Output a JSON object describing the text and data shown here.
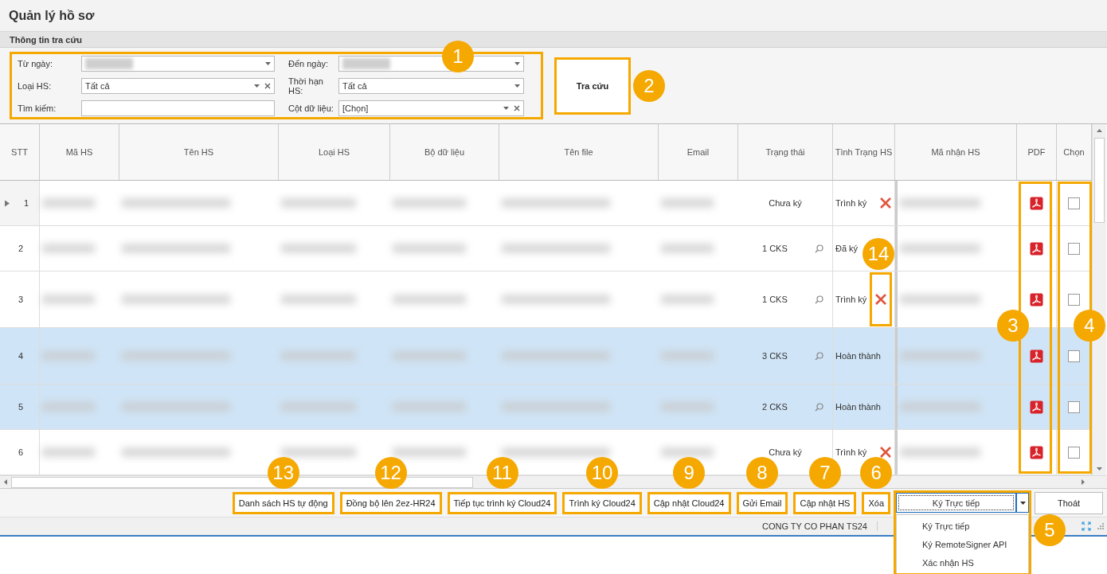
{
  "title": "Quản lý hồ sơ",
  "section_title": "Thông tin tra cứu",
  "filter_panel": {
    "callout": "1",
    "fields": [
      {
        "label": "Từ ngày:",
        "kind": "dropdown",
        "redacted": true
      },
      {
        "label": "Đến ngày:",
        "kind": "dropdown",
        "redacted": true
      },
      {
        "label": "Loại HS:",
        "kind": "dropdown",
        "value": "Tất cả",
        "clearable": true
      },
      {
        "label": "Thời hạn HS:",
        "kind": "dropdown",
        "value": "Tất cả"
      },
      {
        "label": "Tìm kiếm:",
        "kind": "text"
      },
      {
        "label": "Cột dữ liệu:",
        "kind": "dropdown",
        "value": "[Chọn]",
        "clearable": true
      }
    ]
  },
  "search_button": {
    "label": "Tra cứu",
    "callout": "2"
  },
  "table": {
    "columns": [
      "STT",
      "Mã HS",
      "Tên HS",
      "Loại HS",
      "Bộ dữ liệu",
      "Tên file",
      "Email",
      "Trạng thái",
      "Tình Trạng HS",
      "Mã nhận HS",
      "PDF",
      "Chọn"
    ],
    "pdf_callout": "3",
    "select_callout": "4",
    "rows": [
      {
        "stt": "1",
        "current": true,
        "selected": false,
        "status": "Chưa ký",
        "signature_lookup": false,
        "doc_status": "Trình ký",
        "cancel": true,
        "checked": false
      },
      {
        "stt": "2",
        "current": false,
        "selected": false,
        "status": "1 CKS",
        "signature_lookup": true,
        "doc_status": "Đã ký",
        "cancel": false,
        "checked": false
      },
      {
        "stt": "3",
        "current": false,
        "selected": false,
        "status": "1 CKS",
        "signature_lookup": true,
        "doc_status": "Trình ký",
        "cancel": true,
        "cancel_callout": "14",
        "checked": false
      },
      {
        "stt": "4",
        "current": false,
        "selected": true,
        "status": "3 CKS",
        "signature_lookup": true,
        "doc_status": "Hoàn thành",
        "cancel": false,
        "checked": false
      },
      {
        "stt": "5",
        "current": false,
        "selected": true,
        "status": "2 CKS",
        "signature_lookup": true,
        "doc_status": "Hoàn thành",
        "cancel": false,
        "checked": false
      },
      {
        "stt": "6",
        "current": false,
        "selected": false,
        "status": "Chưa ký",
        "signature_lookup": false,
        "doc_status": "Trình ký",
        "cancel": true,
        "checked": false
      }
    ]
  },
  "toolbar": [
    {
      "label": "Danh sách HS tự động",
      "highlighted": true,
      "callout": "13"
    },
    {
      "label": "Đồng bộ lên 2ez-HR24",
      "highlighted": true,
      "callout": "12"
    },
    {
      "label": "Tiếp tục trình ký Cloud24",
      "highlighted": true,
      "callout": "11"
    },
    {
      "label": "Trình ký Cloud24",
      "highlighted": true,
      "callout": "10"
    },
    {
      "label": "Cập nhật Cloud24",
      "highlighted": true,
      "callout": "9"
    },
    {
      "label": "Gửi Email",
      "highlighted": true,
      "callout": "8"
    },
    {
      "label": "Cập nhật HS",
      "highlighted": true,
      "callout": "7"
    },
    {
      "label": "Xóa",
      "highlighted": true,
      "callout": "6"
    }
  ],
  "sign_dropdown": {
    "value": "Ký Trực tiếp",
    "expanded": true,
    "callout": "5",
    "options": [
      "Ký Trực tiếp",
      "Ký RemoteSigner API",
      "Xác nhận HS"
    ]
  },
  "exit_button": "Thoát",
  "status_bar": "CONG TY CO PHAN TS24"
}
